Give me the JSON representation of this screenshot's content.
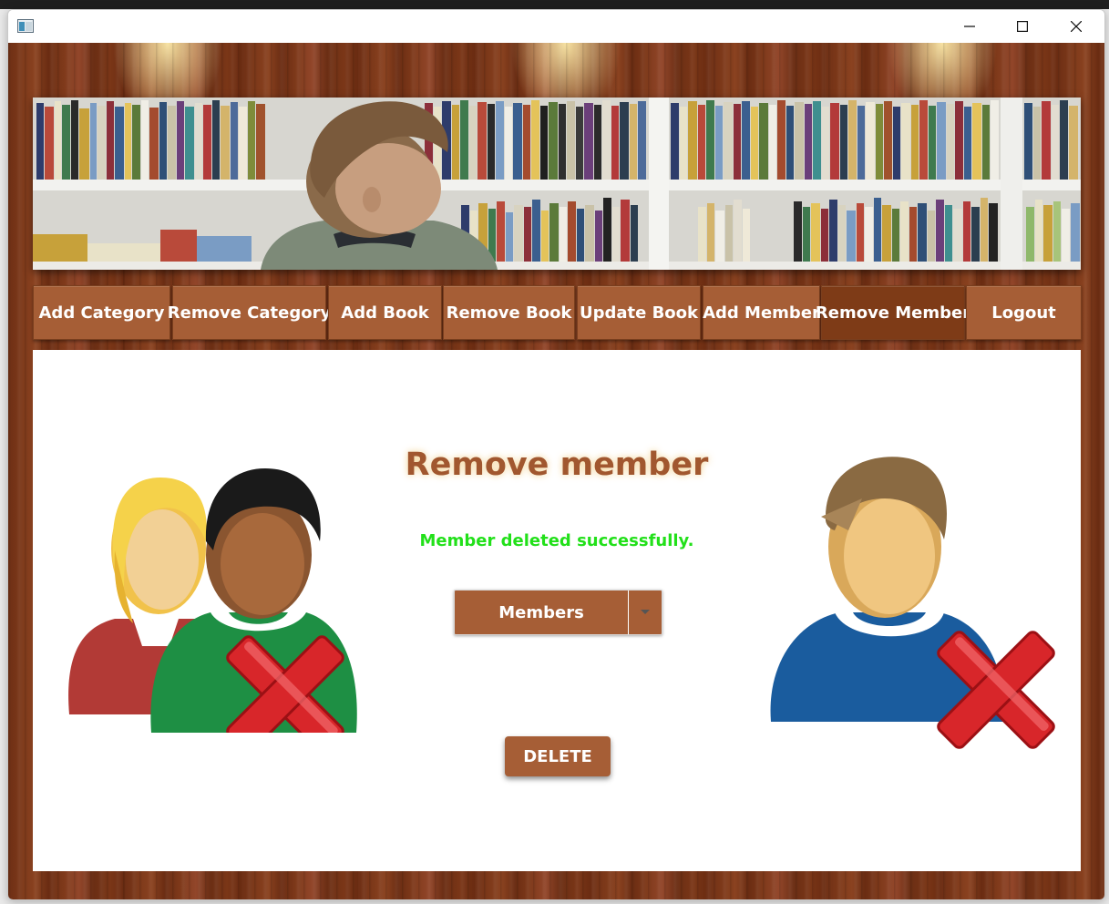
{
  "window": {
    "controls": {
      "minimize": "minimize-icon",
      "maximize": "maximize-icon",
      "close": "close-icon"
    }
  },
  "nav": {
    "items": [
      {
        "label": "Add Category",
        "active": false
      },
      {
        "label": "Remove Category",
        "active": false
      },
      {
        "label": "Add Book",
        "active": false
      },
      {
        "label": "Remove Book",
        "active": false
      },
      {
        "label": "Update Book",
        "active": false
      },
      {
        "label": "Add Member",
        "active": false
      },
      {
        "label": "Remove Member",
        "active": true
      },
      {
        "label": "Logout",
        "active": false
      }
    ]
  },
  "main": {
    "title": "Remove member",
    "status_message": "Member deleted successfully.",
    "members_select": {
      "value": "Members",
      "icon": "chevron-down-icon"
    },
    "delete_label": "DELETE"
  },
  "colors": {
    "accent": "#a65e36",
    "active_tab": "#7e3b17",
    "success": "#22e01a",
    "title": "#a1572f"
  },
  "icons": [
    "app-icon",
    "library-banner",
    "users-remove-icon",
    "user-remove-icon"
  ]
}
